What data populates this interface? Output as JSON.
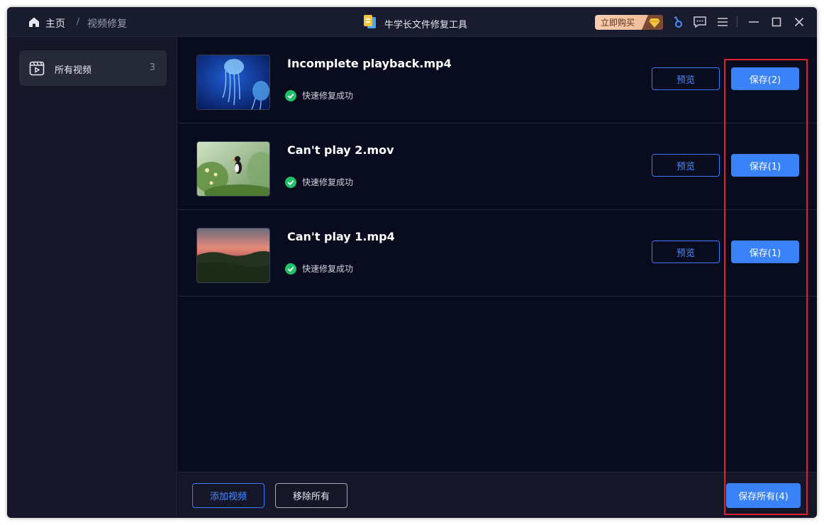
{
  "titlebar": {
    "home_label": "主页",
    "breadcrumb_sep": "/",
    "breadcrumb_current": "视频修复",
    "app_name": "牛学长文件修复工具",
    "buy_label": "立即购买"
  },
  "sidebar": {
    "items": [
      {
        "label": "所有视频",
        "count": "3"
      }
    ]
  },
  "videos": [
    {
      "filename": "Incomplete playback.mp4",
      "status": "快速修复成功",
      "preview_label": "预览",
      "save_label": "保存(2)"
    },
    {
      "filename": "Can't play 2.mov",
      "status": "快速修复成功",
      "preview_label": "预览",
      "save_label": "保存(1)"
    },
    {
      "filename": "Can't play 1.mp4",
      "status": "快速修复成功",
      "preview_label": "预览",
      "save_label": "保存(1)"
    }
  ],
  "bottombar": {
    "add_label": "添加视频",
    "remove_label": "移除所有",
    "save_all_label": "保存所有(4)"
  },
  "colors": {
    "accent": "#3a82f7",
    "success": "#22c06a",
    "highlight": "#e0202a"
  }
}
